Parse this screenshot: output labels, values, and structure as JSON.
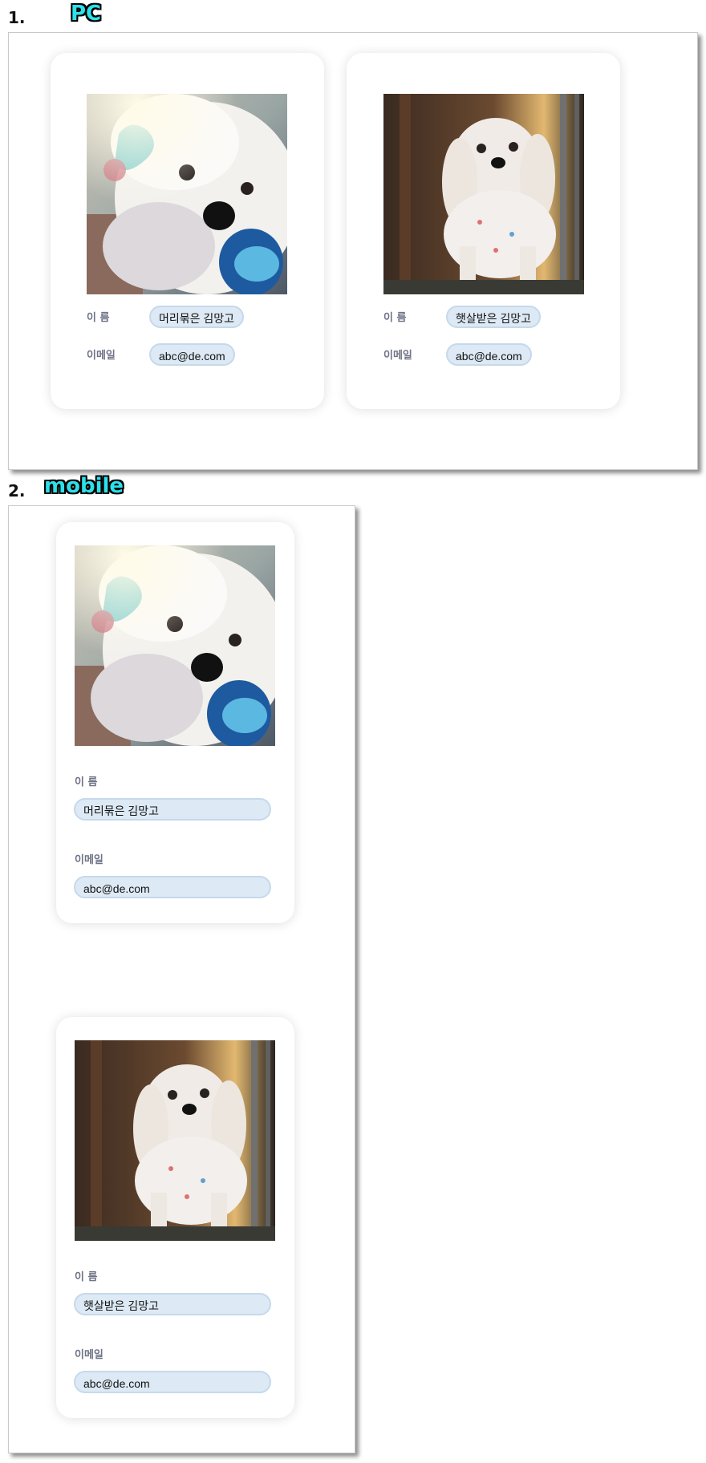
{
  "sections": [
    {
      "number": "1.",
      "title": "PC",
      "cards": [
        {
          "photo_icon": "dog-photo-closeup",
          "name_label": "이 름",
          "name_value": "머리묶은 김망고",
          "email_label": "이메일",
          "email_value": "abc@de.com"
        },
        {
          "photo_icon": "dog-photo-standing",
          "name_label": "이 름",
          "name_value": "햇살받은 김망고",
          "email_label": "이메일",
          "email_value": "abc@de.com"
        }
      ]
    },
    {
      "number": "2.",
      "title": "mobile",
      "cards": [
        {
          "photo_icon": "dog-photo-closeup",
          "name_label": "이 름",
          "name_value": "머리묶은 김망고",
          "email_label": "이메일",
          "email_value": "abc@de.com"
        },
        {
          "photo_icon": "dog-photo-standing",
          "name_label": "이 름",
          "name_value": "햇살받은 김망고",
          "email_label": "이메일",
          "email_value": "abc@de.com"
        }
      ]
    }
  ],
  "colors": {
    "title_accent": "#2de0ea",
    "pill_bg": "#dde9f4",
    "label": "#6d7285"
  }
}
